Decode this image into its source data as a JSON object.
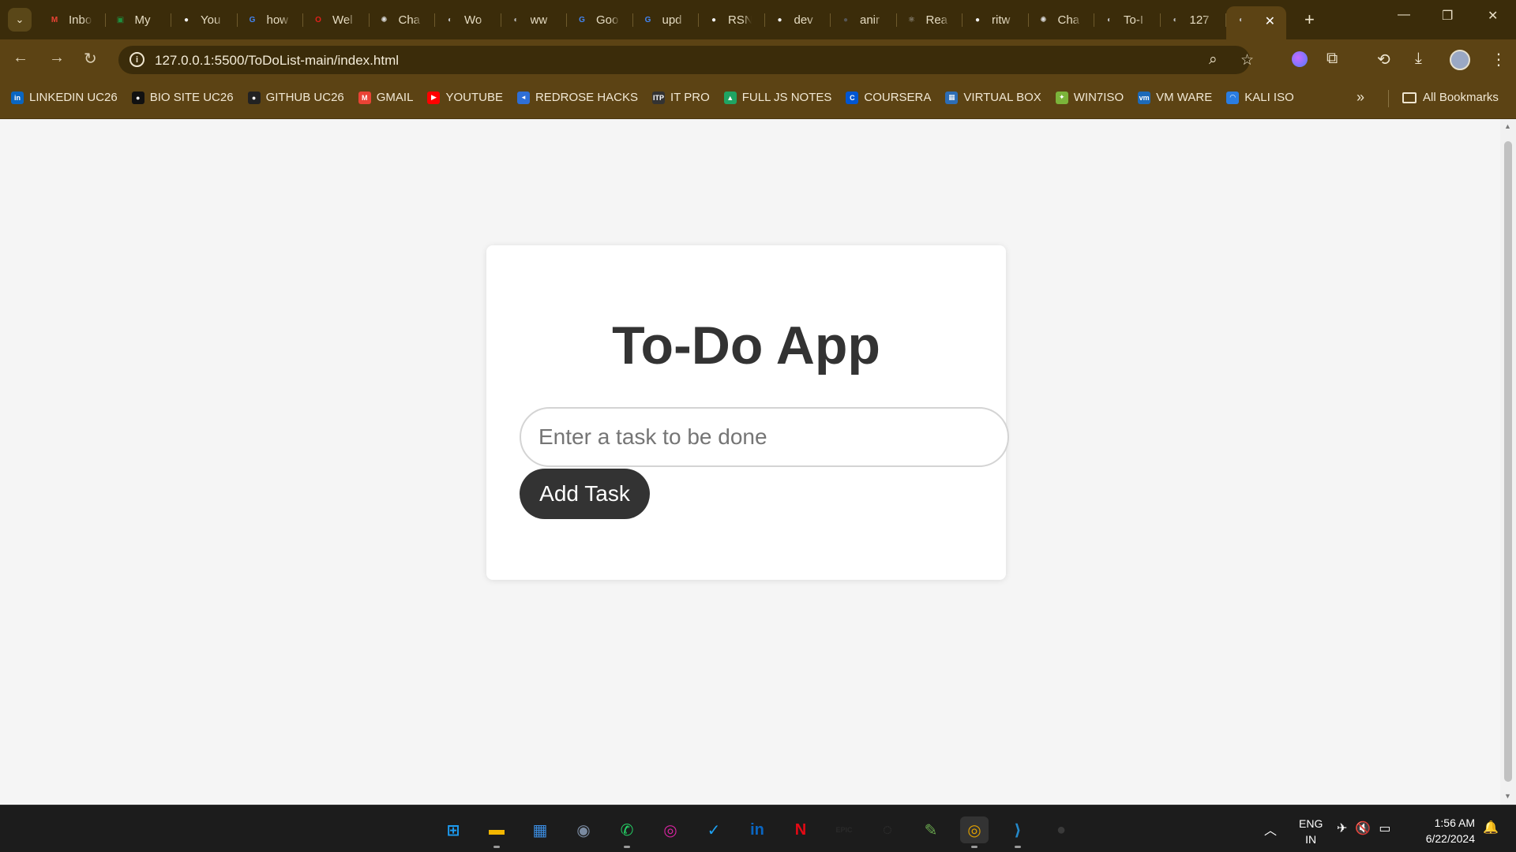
{
  "browser": {
    "tabs": [
      {
        "label": "Inbox",
        "icon": "gmail-icon",
        "color": "#ea4335",
        "glyph": "M"
      },
      {
        "label": "My",
        "icon": "classroom-icon",
        "color": "#1e8e3e",
        "glyph": "▣"
      },
      {
        "label": "You",
        "icon": "github-icon",
        "color": "#f0f0f0",
        "glyph": "●"
      },
      {
        "label": "how",
        "icon": "google-icon",
        "color": "#4285f4",
        "glyph": "G"
      },
      {
        "label": "Wel",
        "icon": "oracle-icon",
        "color": "#e0201b",
        "glyph": "O"
      },
      {
        "label": "Cha",
        "icon": "chatgpt-icon",
        "color": "#dcdcdc",
        "glyph": "✺"
      },
      {
        "label": "Wo",
        "icon": "globe-icon",
        "color": "#bdbdbd",
        "glyph": "◐"
      },
      {
        "label": "ww",
        "icon": "globe-icon",
        "color": "#bdbdbd",
        "glyph": "◐"
      },
      {
        "label": "Goo",
        "icon": "google-icon",
        "color": "#4285f4",
        "glyph": "G"
      },
      {
        "label": "upd",
        "icon": "google-icon",
        "color": "#4285f4",
        "glyph": "G"
      },
      {
        "label": "RSN",
        "icon": "github-icon",
        "color": "#f0f0f0",
        "glyph": "●"
      },
      {
        "label": "dev",
        "icon": "github-icon",
        "color": "#f0f0f0",
        "glyph": "●"
      },
      {
        "label": "anir",
        "icon": "github-icon",
        "color": "#555555",
        "glyph": "●"
      },
      {
        "label": "Rea",
        "icon": "react-icon",
        "color": "#bdbdbd",
        "glyph": "⚛"
      },
      {
        "label": "ritw",
        "icon": "github-icon",
        "color": "#f0f0f0",
        "glyph": "●"
      },
      {
        "label": "Cha",
        "icon": "chatgpt-icon",
        "color": "#dcdcdc",
        "glyph": "✺"
      },
      {
        "label": "To-I",
        "icon": "globe-icon",
        "color": "#bdbdbd",
        "glyph": "◐"
      },
      {
        "label": "127",
        "icon": "globe-icon",
        "color": "#bdbdbd",
        "glyph": "◐"
      }
    ],
    "active_tab": {
      "icon": "globe-icon",
      "close": "✕"
    },
    "new_tab": "+",
    "url": "127.0.0.1:5500/ToDoList-main/index.html",
    "bookmarks": [
      {
        "label": "LINKEDIN UC26",
        "icon": "linkedin-icon",
        "color": "#0a66c2",
        "glyph": "in"
      },
      {
        "label": "BIO SITE UC26",
        "icon": "biosite-icon",
        "color": "#111111",
        "glyph": "●"
      },
      {
        "label": "GITHUB UC26",
        "icon": "github-icon",
        "color": "#222222",
        "glyph": "●"
      },
      {
        "label": "GMAIL",
        "icon": "gmail-icon",
        "color": "#ea4335",
        "glyph": "M"
      },
      {
        "label": "YOUTUBE",
        "icon": "youtube-icon",
        "color": "#ff0000",
        "glyph": "▶"
      },
      {
        "label": "REDROSE HACKS",
        "icon": "redrose-icon",
        "color": "#2f6fd6",
        "glyph": "◂"
      },
      {
        "label": "IT PRO",
        "icon": "itpro-icon",
        "color": "#333333",
        "glyph": "ITP"
      },
      {
        "label": "FULL JS NOTES",
        "icon": "google-drive-icon",
        "color": "#1fa463",
        "glyph": "▲"
      },
      {
        "label": "COURSERA",
        "icon": "coursera-icon",
        "color": "#0056d2",
        "glyph": "C"
      },
      {
        "label": "VIRTUAL BOX",
        "icon": "virtualbox-icon",
        "color": "#2d6db5",
        "glyph": "▦"
      },
      {
        "label": "WIN7ISO",
        "icon": "win7iso-icon",
        "color": "#7bb43a",
        "glyph": "✦"
      },
      {
        "label": "VM WARE",
        "icon": "vmware-icon",
        "color": "#1d6ab8",
        "glyph": "vm"
      },
      {
        "label": "KALI ISO",
        "icon": "kali-icon",
        "color": "#2a7de1",
        "glyph": "◠"
      }
    ],
    "all_bookmarks": "All Bookmarks"
  },
  "page": {
    "title": "To-Do App",
    "input_placeholder": "Enter a task to be done",
    "input_value": "",
    "add_button": "Add Task"
  },
  "taskbar": {
    "apps": [
      {
        "name": "start-icon",
        "color": "#1d9bf0",
        "glyph": "⊞"
      },
      {
        "name": "file-explorer-icon",
        "color": "#f2b600",
        "glyph": "▬"
      },
      {
        "name": "microsoft-store-icon",
        "color": "#3b8ce0",
        "glyph": "▦"
      },
      {
        "name": "camera-icon",
        "color": "#7a8aa0",
        "glyph": "◉"
      },
      {
        "name": "whatsapp-icon",
        "color": "#25d366",
        "glyph": "✆"
      },
      {
        "name": "instagram-icon",
        "color": "#d6249f",
        "glyph": "◎"
      },
      {
        "name": "twitter-icon",
        "color": "#1da1f2",
        "glyph": "✓"
      },
      {
        "name": "linkedin-icon",
        "color": "#0a66c2",
        "glyph": "in"
      },
      {
        "name": "netflix-icon",
        "color": "#e50914",
        "glyph": "N"
      },
      {
        "name": "epic-games-icon",
        "color": "#2a2a2a",
        "glyph": "EPIC"
      },
      {
        "name": "obs-icon",
        "color": "#3a3a3a",
        "glyph": "◌"
      },
      {
        "name": "notepad-icon",
        "color": "#6aa84f",
        "glyph": "✎"
      },
      {
        "name": "chrome-icon",
        "color": "#e0a000",
        "glyph": "◎"
      },
      {
        "name": "vscode-icon",
        "color": "#2489ca",
        "glyph": "⟩"
      },
      {
        "name": "github-desktop-icon",
        "color": "#3a3a3a",
        "glyph": "●"
      }
    ],
    "lang_line1": "ENG",
    "lang_line2": "IN",
    "time": "1:56 AM",
    "date": "6/22/2024"
  }
}
